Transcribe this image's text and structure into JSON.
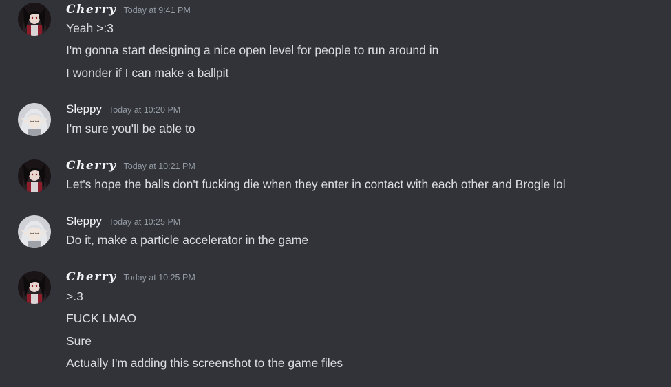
{
  "messages": [
    {
      "author": "Cherry",
      "timestamp": "Today at 9:41 PM",
      "lines": [
        "Yeah >:3",
        "I'm gonna start designing a nice open level for people to run around in",
        "I wonder if I can make a ballpit"
      ]
    },
    {
      "author": "Sleppy",
      "timestamp": "Today at 10:20 PM",
      "lines": [
        "I'm sure you'll be able to"
      ]
    },
    {
      "author": "Cherry",
      "timestamp": "Today at 10:21 PM",
      "lines": [
        "Let's hope the balls don't fucking die when they enter in contact with each other and Brogle lol"
      ]
    },
    {
      "author": "Sleppy",
      "timestamp": "Today at 10:25 PM",
      "lines": [
        "Do it, make a particle accelerator in the game"
      ]
    },
    {
      "author": "Cherry",
      "timestamp": "Today at 10:25 PM",
      "lines": [
        ">.3",
        "FUCK LMAO",
        "Sure",
        "Actually I'm adding this screenshot to the game files"
      ]
    }
  ],
  "colors": {
    "background": "#313338",
    "text": "#dbdee1",
    "username": "#f2f3f5",
    "timestamp": "#949ba4"
  },
  "icons": {
    "cherry_avatar": "dark-haired-character-avatar-icon",
    "sleppy_avatar": "silver-haired-elf-avatar-icon"
  }
}
